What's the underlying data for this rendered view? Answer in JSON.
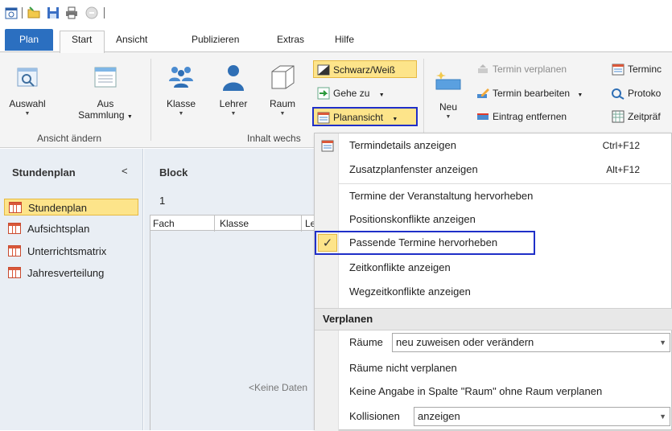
{
  "quick_access": {
    "icons": [
      "calendar-icon",
      "open-folder-icon",
      "save-icon",
      "print-icon",
      "undo-icon"
    ]
  },
  "tabs": {
    "plan": "Plan",
    "start": "Start",
    "ansicht": "Ansicht",
    "publizieren": "Publizieren",
    "extras": "Extras",
    "hilfe": "Hilfe"
  },
  "ribbon": {
    "auswahl": "Auswahl",
    "aus_sammlung_1": "Aus",
    "aus_sammlung_2": "Sammlung",
    "group_ansicht": "Ansicht ändern",
    "klasse": "Klasse",
    "lehrer": "Lehrer",
    "raum": "Raum",
    "group_inhalt": "Inhalt wechs",
    "schwarz_weiss": "Schwarz/Weiß",
    "gehe_zu": "Gehe zu",
    "planansicht": "Planansicht",
    "neu": "Neu",
    "termin_verplanen": "Termin verplanen",
    "termin_bearbeiten": "Termin bearbeiten",
    "eintrag_entfernen": "Eintrag entfernen",
    "terminc": "Terminc",
    "protoko": "Protoko",
    "zeitpraef": "Zeitpräf"
  },
  "left_pane": {
    "title": "Stundenplan",
    "collapse": "<",
    "items": [
      "Stundenplan",
      "Aufsichtsplan",
      "Unterrichtsmatrix",
      "Jahresverteilung"
    ]
  },
  "main": {
    "title": "Block",
    "number": "1",
    "columns": [
      "Fach",
      "Klasse",
      "Le"
    ],
    "no_data": "<Keine Daten"
  },
  "menu": {
    "items": [
      {
        "label": "Termindetails anzeigen",
        "shortcut": "Ctrl+F12"
      },
      {
        "label": "Zusatzplanfenster anzeigen",
        "shortcut": "Alt+F12"
      },
      {
        "label": "Termine der Veranstaltung hervorheben"
      },
      {
        "label": "Positionskonflikte anzeigen"
      },
      {
        "label": "Passende Termine hervorheben"
      },
      {
        "label": "Zeitkonflikte anzeigen"
      },
      {
        "label": "Wegzeitkonflikte anzeigen"
      }
    ],
    "section": "Verplanen",
    "raeume_label": "Räume",
    "raeume_value": "neu zuweisen oder verändern",
    "raeume_nicht": "Räume nicht verplanen",
    "keine_angabe": "Keine Angabe in Spalte \"Raum\" ohne Raum verplanen",
    "kollisionen_label": "Kollisionen",
    "kollisionen_value": "anzeigen"
  }
}
